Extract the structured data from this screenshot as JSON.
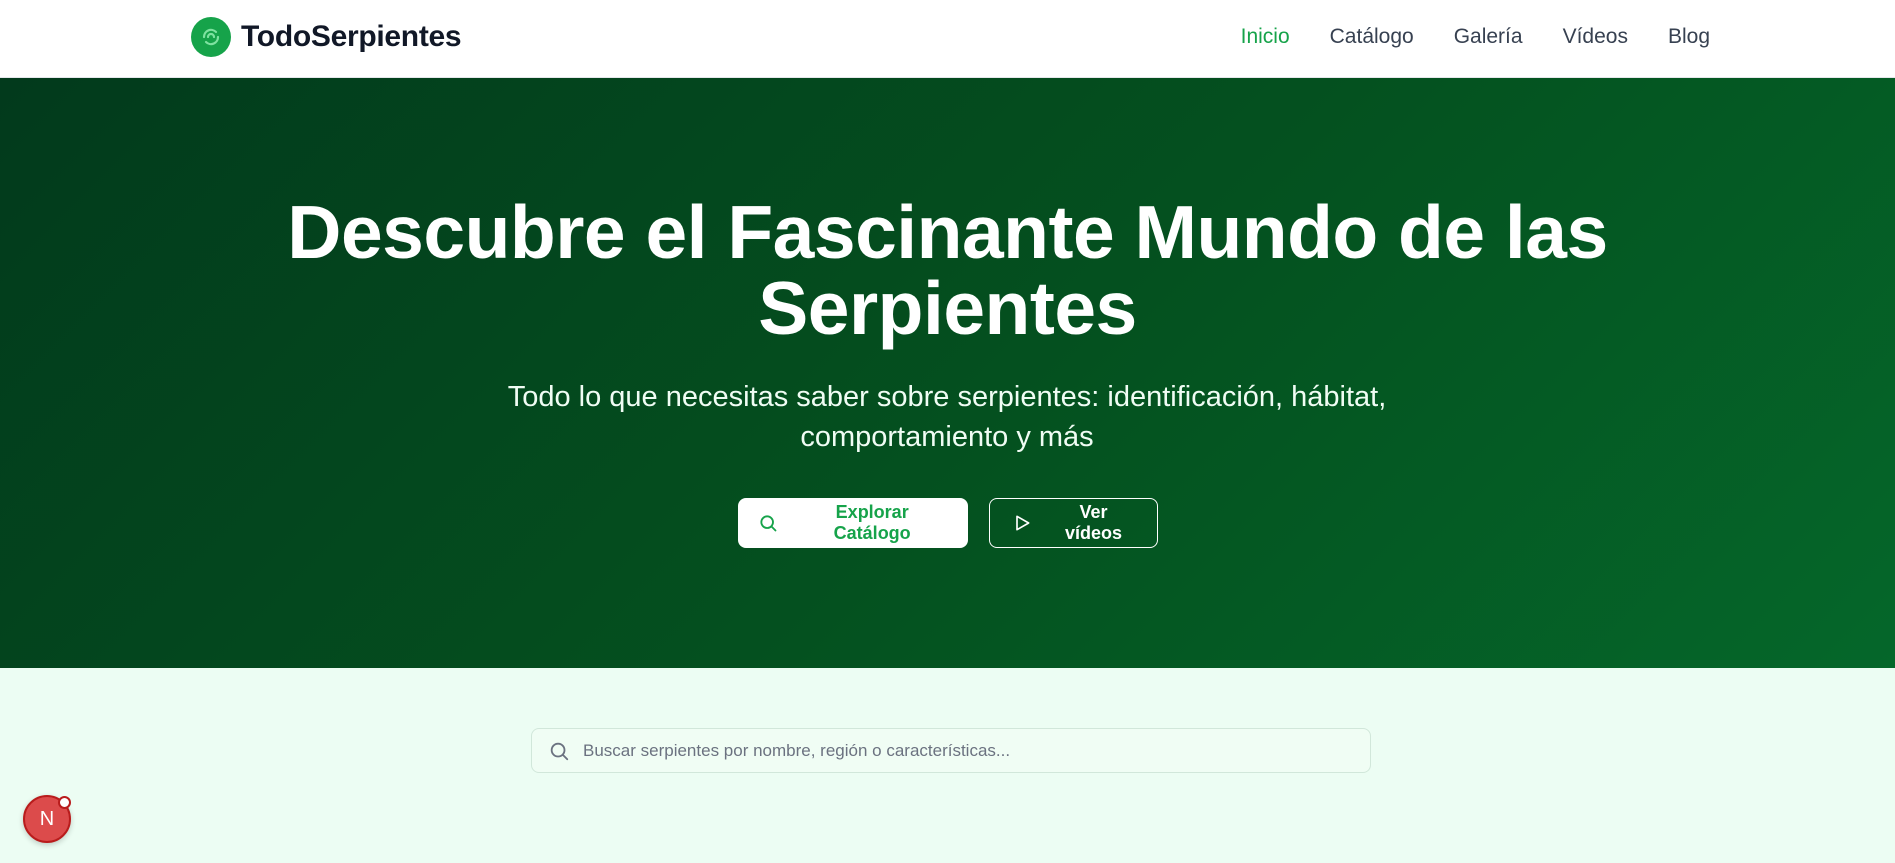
{
  "header": {
    "brand": "TodoSerpientes",
    "logo_icon": "snake-logo-icon",
    "nav": [
      {
        "label": "Inicio",
        "active": true
      },
      {
        "label": "Catálogo",
        "active": false
      },
      {
        "label": "Galería",
        "active": false
      },
      {
        "label": "Vídeos",
        "active": false
      },
      {
        "label": "Blog",
        "active": false
      }
    ]
  },
  "hero": {
    "title": "Descubre el Fascinante Mundo de las Serpientes",
    "subtitle": "Todo lo que necesitas saber sobre serpientes: identificación, hábitat, comportamiento y más",
    "primary_button": "Explorar Catálogo",
    "secondary_button": "Ver vídeos"
  },
  "search": {
    "placeholder": "Buscar serpientes por nombre, región o características...",
    "value": ""
  },
  "dev_badge": {
    "letter": "N"
  },
  "colors": {
    "accent": "#16a34a",
    "hero_dark": "#023a1c",
    "hero_light": "#05672a",
    "page_bg": "#ecfdf3"
  }
}
